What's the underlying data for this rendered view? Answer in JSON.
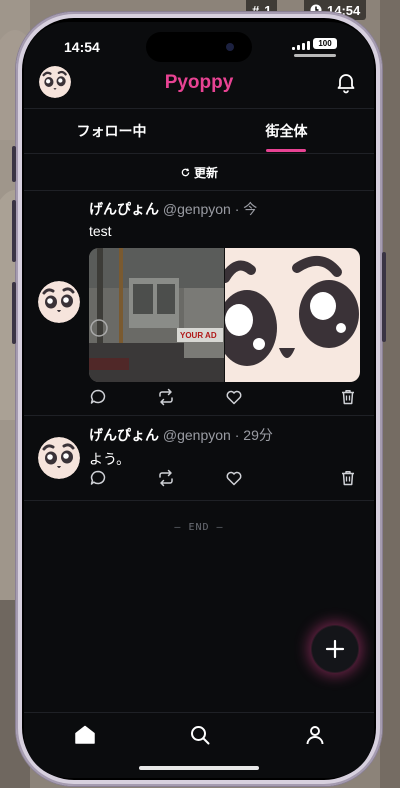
{
  "overlay": {
    "workspace": "1",
    "clock": "14:54"
  },
  "status": {
    "time": "14:54",
    "battery": "100"
  },
  "header": {
    "title": "Pyoppy"
  },
  "tabs": [
    {
      "label": "フォロー中"
    },
    {
      "label": "街全体",
      "active": true
    }
  ],
  "refresh": {
    "label": "更新"
  },
  "posts": [
    {
      "name": "げんぴょん",
      "handle": "@genpyon",
      "time": "今",
      "text": "test",
      "image_sign": "YOUR AD"
    },
    {
      "name": "げんぴょん",
      "handle": "@genpyon",
      "time": "29分",
      "text": "よう。"
    }
  ],
  "end_label": "— END —",
  "colors": {
    "accent": "#e84393",
    "background": "#0b0c0e",
    "text": "#ffffff",
    "muted": "#9a9ca3"
  },
  "icons": [
    "reply-icon",
    "repost-icon",
    "heart-icon",
    "trash-icon",
    "bell-icon",
    "plus-icon",
    "home-icon",
    "search-icon",
    "profile-icon",
    "refresh-icon"
  ]
}
